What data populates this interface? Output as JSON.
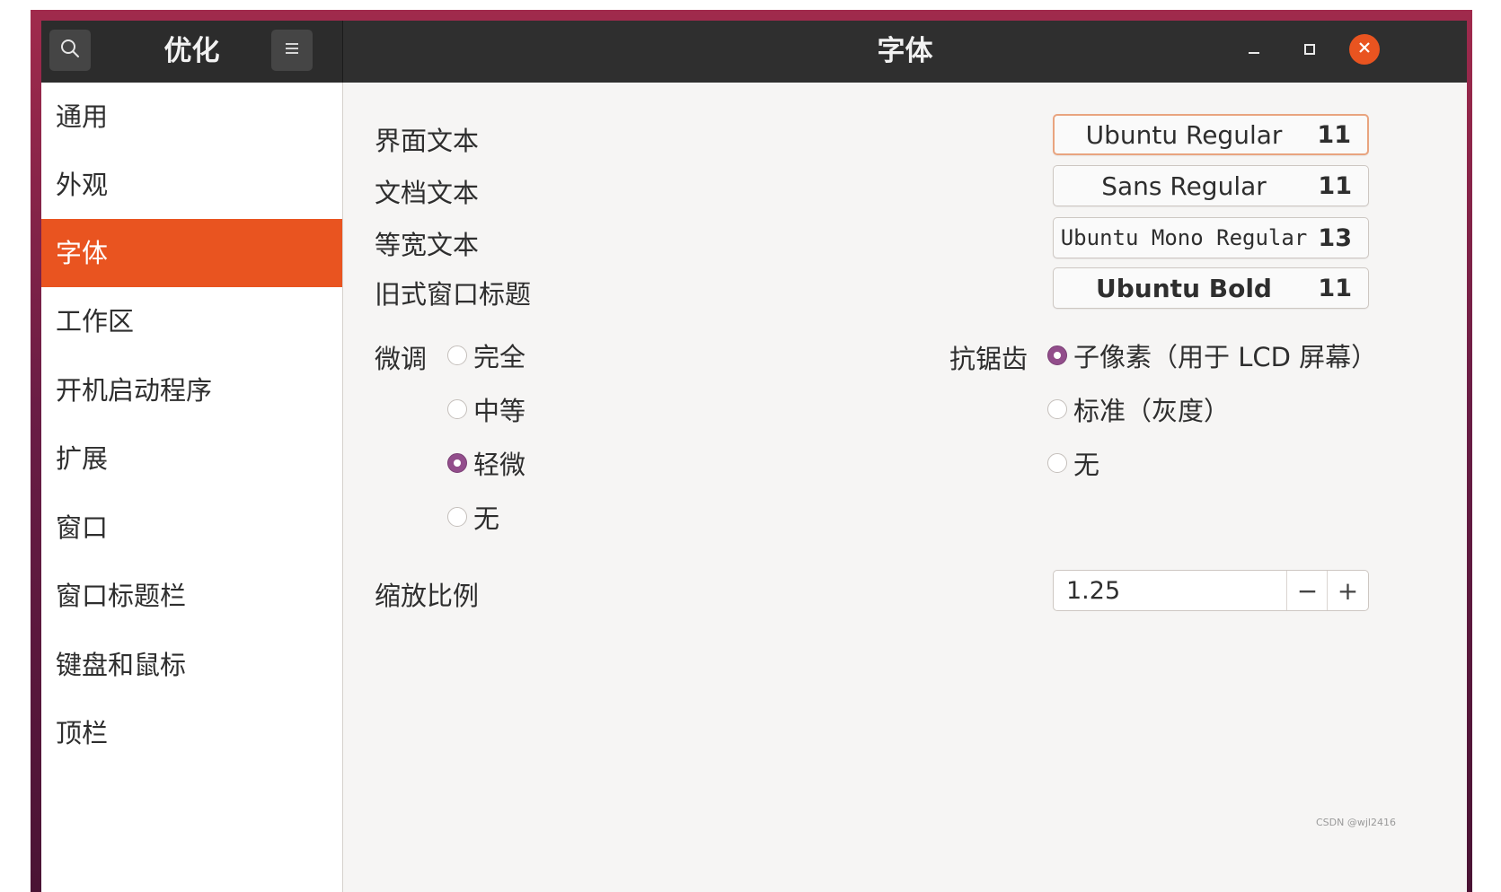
{
  "header": {
    "app_title": "优化",
    "page_title": "字体",
    "search_icon": "search-icon",
    "menu_icon": "hamburger-menu-icon",
    "minimize_icon": "minimize-icon",
    "maximize_icon": "maximize-icon",
    "close_icon": "close-icon"
  },
  "sidebar": {
    "items": [
      {
        "label": "通用"
      },
      {
        "label": "外观"
      },
      {
        "label": "字体"
      },
      {
        "label": "工作区"
      },
      {
        "label": "开机启动程序"
      },
      {
        "label": "扩展"
      },
      {
        "label": "窗口"
      },
      {
        "label": "窗口标题栏"
      },
      {
        "label": "键盘和鼠标"
      },
      {
        "label": "顶栏"
      }
    ],
    "active": "字体"
  },
  "fonts": {
    "interface": {
      "label": "界面文本",
      "name": "Ubuntu Regular",
      "size": "11"
    },
    "document": {
      "label": "文档文本",
      "name": "Sans Regular",
      "size": "11"
    },
    "monospace": {
      "label": "等宽文本",
      "name": "Ubuntu Mono Regular",
      "size": "13"
    },
    "legacy_title": {
      "label": "旧式窗口标题",
      "name": "Ubuntu Bold",
      "size": "11"
    }
  },
  "hinting": {
    "label": "微调",
    "options": [
      "完全",
      "中等",
      "轻微",
      "无"
    ],
    "selected": "轻微"
  },
  "antialiasing": {
    "label": "抗锯齿",
    "options": [
      "子像素（用于 LCD 屏幕）",
      "标准（灰度）",
      "无"
    ],
    "selected": "子像素（用于 LCD 屏幕）"
  },
  "scaling": {
    "label": "缩放比例",
    "value": "1.25",
    "decrement": "−",
    "increment": "+"
  },
  "watermark": "CSDN @wjl2416",
  "colors": {
    "accent": "#e95420",
    "radio_checked": "#924d8b",
    "header_bg": "#2f2f2f"
  }
}
